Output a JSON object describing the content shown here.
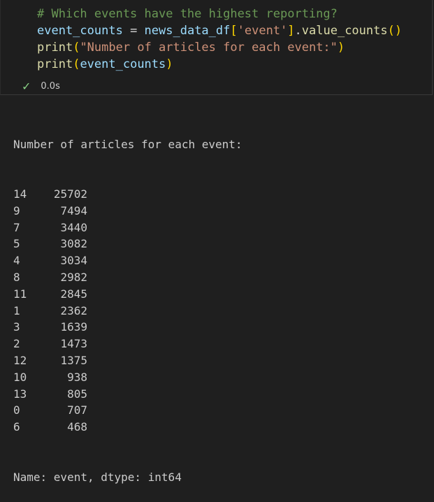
{
  "cell": {
    "code_lines": [
      [
        {
          "t": "# Which events have the highest reporting?",
          "c": "cmt"
        }
      ],
      [
        {
          "t": "event_counts",
          "c": "var"
        },
        {
          "t": " = ",
          "c": ""
        },
        {
          "t": "news_data_df",
          "c": "var"
        },
        {
          "t": "[",
          "c": "br1"
        },
        {
          "t": "'event'",
          "c": "str"
        },
        {
          "t": "]",
          "c": "br1"
        },
        {
          "t": ".",
          "c": ""
        },
        {
          "t": "value_counts",
          "c": "fn"
        },
        {
          "t": "()",
          "c": "br1"
        }
      ],
      [
        {
          "t": "print",
          "c": "fn"
        },
        {
          "t": "(",
          "c": "br1"
        },
        {
          "t": "\"Number of articles for each event:\"",
          "c": "str"
        },
        {
          "t": ")",
          "c": "br1"
        }
      ],
      [
        {
          "t": "print",
          "c": "fn"
        },
        {
          "t": "(",
          "c": "br1"
        },
        {
          "t": "event_counts",
          "c": "var"
        },
        {
          "t": ")",
          "c": "br1"
        }
      ]
    ],
    "status_icon": "check-icon",
    "exec_time": "0.0s"
  },
  "output": {
    "header": "Number of articles for each event:",
    "rows": [
      {
        "index": "14",
        "value": "25702"
      },
      {
        "index": "9",
        "value": "7494"
      },
      {
        "index": "7",
        "value": "3440"
      },
      {
        "index": "5",
        "value": "3082"
      },
      {
        "index": "4",
        "value": "3034"
      },
      {
        "index": "8",
        "value": "2982"
      },
      {
        "index": "11",
        "value": "2845"
      },
      {
        "index": "1",
        "value": "2362"
      },
      {
        "index": "3",
        "value": "1639"
      },
      {
        "index": "2",
        "value": "1473"
      },
      {
        "index": "12",
        "value": "1375"
      },
      {
        "index": "10",
        "value": "938"
      },
      {
        "index": "13",
        "value": "805"
      },
      {
        "index": "0",
        "value": "707"
      },
      {
        "index": "6",
        "value": "468"
      }
    ],
    "footer": "Name: event, dtype: int64"
  },
  "colors": {
    "background": "#1f1f1f",
    "comment": "#6a9955",
    "variable": "#9cdcfe",
    "function": "#dcdcaa",
    "string": "#ce9178",
    "bracket": "#ffd700",
    "success": "#89d185"
  }
}
